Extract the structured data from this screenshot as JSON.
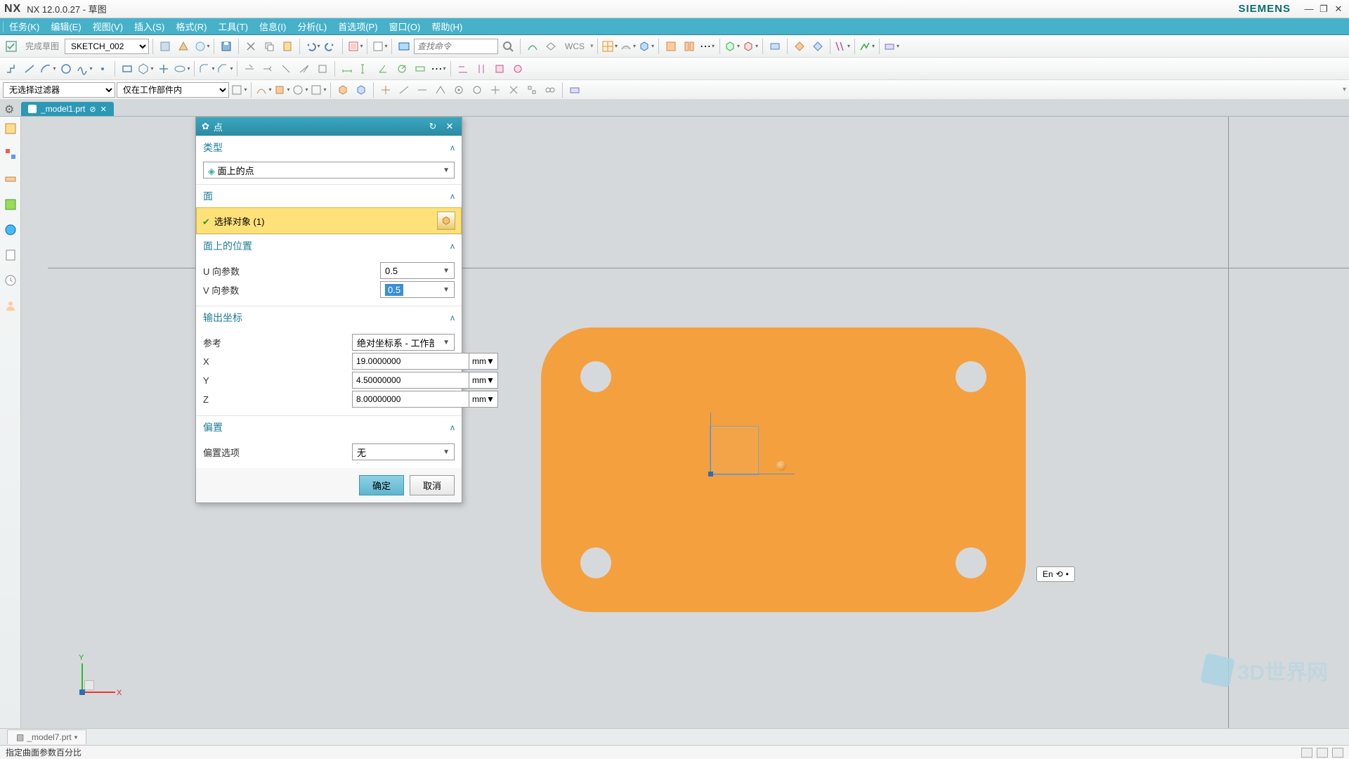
{
  "app": {
    "logo": "NX",
    "title": "NX 12.0.0.27 - 草图",
    "brand": "SIEMENS"
  },
  "menu": [
    "任务(K)",
    "编辑(E)",
    "视图(V)",
    "插入(S)",
    "格式(R)",
    "工具(T)",
    "信息(I)",
    "分析(L)",
    "首选项(P)",
    "窗口(O)",
    "帮助(H)"
  ],
  "toolbar1": {
    "finish_sketch": "完成草图",
    "sketch_name": "SKETCH_002",
    "search_placeholder": "查找命令",
    "wcs": "WCS"
  },
  "toolbar3": {
    "filter": "无选择过滤器",
    "scope": "仅在工作部件内"
  },
  "file_tab": {
    "name": "_model1.prt"
  },
  "dialog": {
    "title": "点",
    "sec_type": "类型",
    "type_value": "面上的点",
    "sec_face": "面",
    "select_face": "选择对象 (1)",
    "sec_loc": "面上的位置",
    "u_label": "U 向参数",
    "u_value": "0.5",
    "v_label": "V 向参数",
    "v_value": "0.5",
    "sec_out": "输出坐标",
    "ref_label": "参考",
    "ref_value": "绝对坐标系 - 工作部",
    "x_label": "X",
    "x_value": "19.0000000",
    "unit": "mm",
    "y_label": "Y",
    "y_value": "4.50000000",
    "z_label": "Z",
    "z_value": "8.00000000",
    "sec_offset": "偏置",
    "offset_label": "偏置选项",
    "offset_value": "无",
    "ok": "确定",
    "cancel": "取消"
  },
  "ime": "En",
  "bottom_tab": "_model7.prt",
  "status": "指定曲面参数百分比",
  "watermark": "3D世界网",
  "axes": {
    "x": "X",
    "y": "Y"
  }
}
